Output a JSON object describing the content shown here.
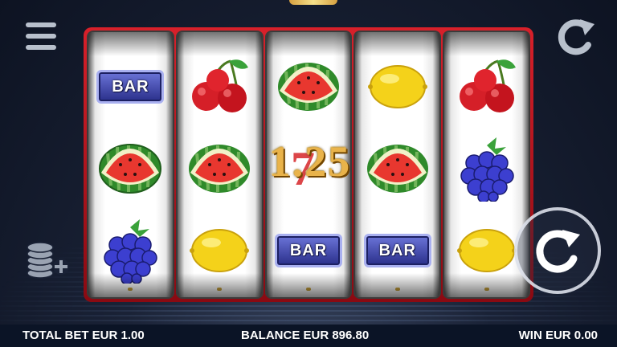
{
  "colors": {
    "frame": "#d8202a",
    "background": "#1a2236",
    "win_text": "#e9b34a",
    "bar_symbol": "#2a2f8a"
  },
  "reels": [
    {
      "symbols": [
        "BAR",
        "watermelon",
        "blackberry"
      ]
    },
    {
      "symbols": [
        "cherries",
        "watermelon",
        "lemon"
      ]
    },
    {
      "symbols": [
        "watermelon",
        "seven",
        "BAR"
      ]
    },
    {
      "symbols": [
        "lemon",
        "watermelon",
        "BAR"
      ]
    },
    {
      "symbols": [
        "cherries",
        "blackberry",
        "lemon"
      ]
    }
  ],
  "bar_label": "BAR",
  "win_display": "1.25",
  "seven_glyph": "7",
  "icons": {
    "menu": "hamburger-menu-icon",
    "top_right": "restart-icon",
    "coins": "coin-stack-plus-icon",
    "spin": "spin-icon"
  },
  "status": {
    "total_bet": "TOTAL BET EUR 1.00",
    "balance": "BALANCE EUR 896.80",
    "win": "WIN EUR 0.00"
  }
}
